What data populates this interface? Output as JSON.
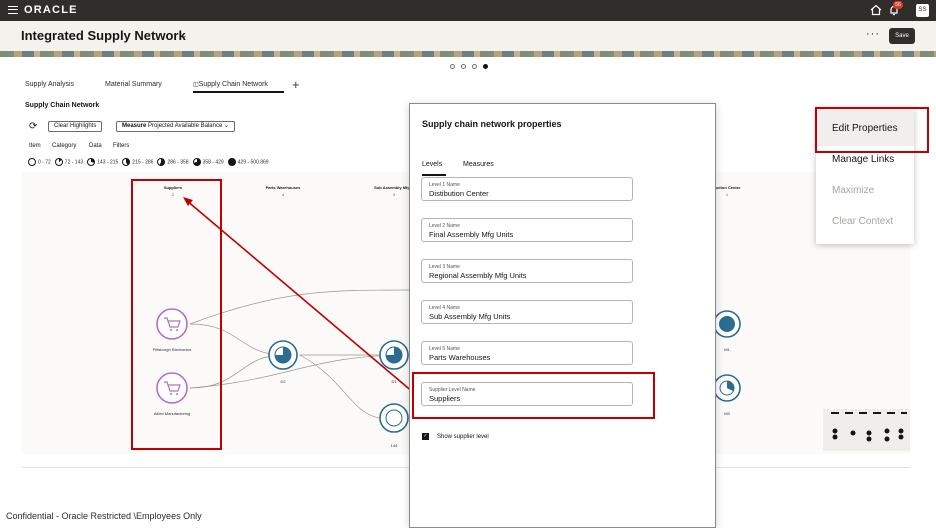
{
  "topbar": {
    "logo": "ORACLE",
    "notification_count": "56",
    "avatar_initials": "SS"
  },
  "header": {
    "title": "Integrated Supply Network",
    "more": "···",
    "save_label": "Save"
  },
  "tabs": [
    "Supply Analysis",
    "Material Summary",
    "Supply Chain Network"
  ],
  "section": {
    "title": "Supply Chain Network"
  },
  "toolbar": {
    "clear_highlights": "Clear Highlights",
    "measure_label": "Measure",
    "measure_value": "Projected Available Balance"
  },
  "filters": [
    "Item",
    "Category",
    "Data",
    "Filters"
  ],
  "legend": [
    "0 - 72",
    "72 - 143",
    "143 - 215",
    "215 - 286",
    "286 - 358",
    "358 - 429",
    "429 - 500.869"
  ],
  "levels": [
    {
      "name": "Suppliers",
      "count": "2"
    },
    {
      "name": "Parts Warehouses",
      "count": "4"
    },
    {
      "name": "Sub Assembly Mfg U",
      "count": "3"
    },
    {
      "name": "ibution Center",
      "count": "1"
    }
  ],
  "nodes": {
    "supplier_1": "Pittsburgh Electronics",
    "supplier_2": "Allied Manufacturing",
    "d2": "D2",
    "d1": "D1",
    "m144": "144",
    "m1": "M1",
    "m3": "M3"
  },
  "panel": {
    "title": "Supply chain network properties",
    "tabs": [
      "Levels",
      "Measures"
    ],
    "fields": [
      {
        "label": "Level 1 Name",
        "value": "Distibution Center"
      },
      {
        "label": "Level 2 Name",
        "value": "Final Assembly Mfg Units"
      },
      {
        "label": "Level 3 Name",
        "value": "Regional Assembly Mfg Units"
      },
      {
        "label": "Level 4 Name",
        "value": "Sub Assembly Mfg Units"
      },
      {
        "label": "Level 5 Name",
        "value": "Parts Warehouses"
      },
      {
        "label": "Supplier Level Name",
        "value": "Suppliers"
      }
    ],
    "show_supplier_label": "Show supplier level"
  },
  "context_menu": [
    "Edit Properties",
    "Manage Links",
    "Maximize",
    "Clear Context"
  ],
  "footer": {
    "confidential": "Confidential - Oracle Restricted \\Employees Only"
  },
  "colors": {
    "topbar": "#312d2a",
    "highlight": "#c00000",
    "supplier_node": "#b46fc6",
    "node_blue": "#2b6c8f"
  }
}
